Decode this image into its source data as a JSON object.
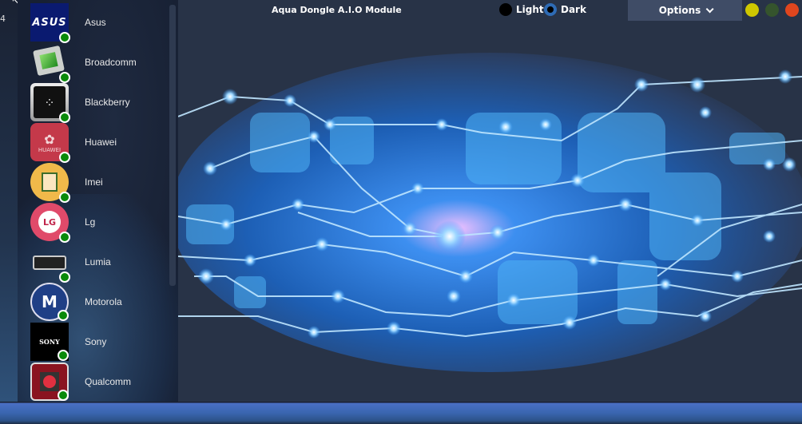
{
  "window": {
    "title": "Aqua Dongle A.I.O Module",
    "left_edge_text": "4"
  },
  "theme": {
    "light_label": "Light",
    "dark_label": "Dark",
    "selected": "Dark"
  },
  "options": {
    "label": "Options",
    "icon": "chevron-down-icon"
  },
  "window_buttons": [
    {
      "name": "minimize",
      "color": "#cfc800"
    },
    {
      "name": "maximize",
      "color": "#35542d"
    },
    {
      "name": "close",
      "color": "#e0461e"
    }
  ],
  "sidebar": {
    "items": [
      {
        "label": "Asus",
        "status": "online"
      },
      {
        "label": "Broadcomm",
        "status": "online"
      },
      {
        "label": "Blackberry",
        "status": "online"
      },
      {
        "label": "Huawei",
        "status": "online"
      },
      {
        "label": "Imei",
        "status": "online"
      },
      {
        "label": "Lg",
        "status": "online"
      },
      {
        "label": "Lumia",
        "status": "online"
      },
      {
        "label": "Motorola",
        "status": "online"
      },
      {
        "label": "Sony",
        "status": "online"
      },
      {
        "label": "Qualcomm",
        "status": "online"
      }
    ],
    "logo_text": {
      "asus": "ASUS",
      "huawei": "HUAWEI",
      "sony": "SONY",
      "lg": "LG"
    }
  },
  "colors": {
    "status_online": "#0a8a0a",
    "accent": "#2e6bb5"
  }
}
